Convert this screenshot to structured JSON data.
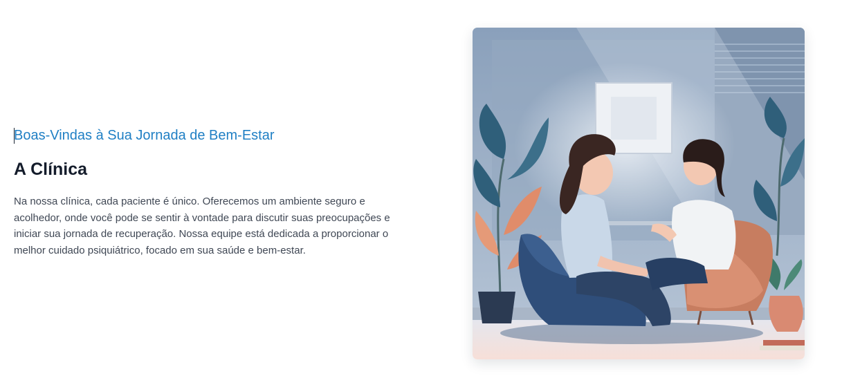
{
  "section": {
    "eyebrow": "Boas-Vindas à Sua Jornada de Bem-Estar",
    "title": "A Clínica",
    "body": "Na nossa clínica, cada paciente é único. Oferecemos um ambiente seguro e acolhedor, onde você pode se sentir à vontade para discutir suas preocupações e iniciar sua jornada de recuperação. Nossa equipe está dedicada a proporcionar o melhor cuidado psiquiátrico, focado em sua saúde e bem-estar."
  },
  "illustration": {
    "icon": "therapy-session-illustration"
  },
  "colors": {
    "accent": "#1f7fc4",
    "heading": "#141c2b",
    "body": "#3f4754"
  }
}
